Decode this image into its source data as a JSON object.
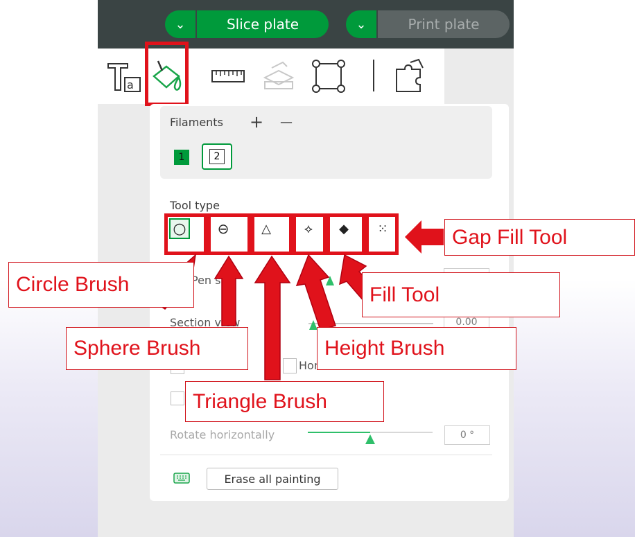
{
  "header": {
    "slice_label": "Slice plate",
    "print_label": "Print plate",
    "dropdown_glyph": "⌄"
  },
  "toolbar": {
    "icons": [
      "text-icon",
      "paint-bucket-icon",
      "ruler-icon",
      "assembly-icon",
      "bounding-box-icon",
      "puzzle-icon"
    ]
  },
  "filaments": {
    "label": "Filaments",
    "add": "+",
    "remove": "—",
    "items": [
      "1",
      "2"
    ]
  },
  "tool_type": {
    "label": "Tool type",
    "tools": [
      {
        "name": "circle-brush",
        "glyph": "○"
      },
      {
        "name": "sphere-brush",
        "glyph": "⊖"
      },
      {
        "name": "triangle-brush",
        "glyph": "△"
      },
      {
        "name": "height-brush",
        "glyph": "⟡"
      },
      {
        "name": "fill-tool",
        "glyph": "◆"
      },
      {
        "name": "gap-fill-tool",
        "glyph": "⁙"
      }
    ]
  },
  "settings": {
    "size_label_partial": "Pen siz",
    "section_view_label": "Section view",
    "section_view_value": "0.00",
    "horizontal_partial": "Hor",
    "rotate_label": "Rotate horizontally",
    "rotate_value": "0 °"
  },
  "erase": {
    "label": "Erase all painting"
  },
  "callouts": {
    "gap_fill": "Gap Fill Tool",
    "circle": "Circle Brush",
    "fill": "Fill Tool",
    "sphere": "Sphere Brush",
    "height": "Height Brush",
    "triangle": "Triangle Brush"
  },
  "colors": {
    "accent_green": "#009a3b",
    "highlight_red": "#e0121b",
    "topbar": "#3a4444"
  }
}
